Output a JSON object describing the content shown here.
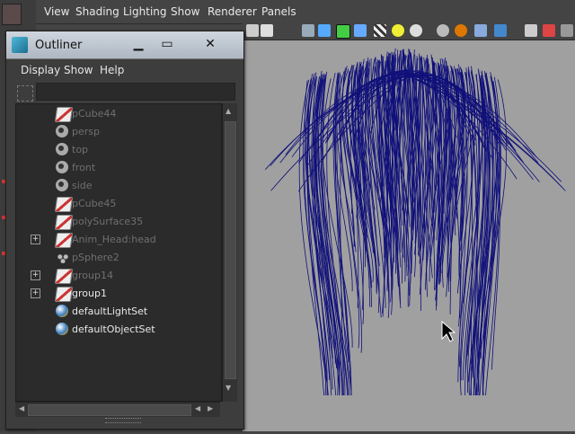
{
  "app_menu": [
    "View",
    "Shading",
    "Lighting",
    "Show",
    "Renderer",
    "Panels"
  ],
  "outliner": {
    "title": "Outliner",
    "menu": [
      "Display",
      "Show",
      "Help"
    ],
    "filter_value": "",
    "items": [
      {
        "label": "pCube44",
        "icon": "mesh-icon",
        "expandable": false,
        "dim": true
      },
      {
        "label": "persp",
        "icon": "camera-icon",
        "expandable": false,
        "dim": true
      },
      {
        "label": "top",
        "icon": "camera-icon",
        "expandable": false,
        "dim": true
      },
      {
        "label": "front",
        "icon": "camera-icon",
        "expandable": false,
        "dim": true
      },
      {
        "label": "side",
        "icon": "camera-icon",
        "expandable": false,
        "dim": true
      },
      {
        "label": "pCube45",
        "icon": "mesh-icon",
        "expandable": false,
        "dim": true
      },
      {
        "label": "polySurface35",
        "icon": "mesh-icon",
        "expandable": false,
        "dim": true
      },
      {
        "label": "Anim_Head:head",
        "icon": "mesh-icon",
        "expandable": true,
        "dim": true
      },
      {
        "label": "pSphere2",
        "icon": "sphere-icon",
        "expandable": false,
        "dim": true
      },
      {
        "label": "group14",
        "icon": "mesh-icon",
        "expandable": true,
        "dim": true
      },
      {
        "label": "group1",
        "icon": "mesh-icon",
        "expandable": true,
        "dim": false
      },
      {
        "label": "defaultLightSet",
        "icon": "set-icon",
        "expandable": false,
        "dim": false
      },
      {
        "label": "defaultObjectSet",
        "icon": "set-icon",
        "expandable": false,
        "dim": false
      }
    ]
  },
  "colors": {
    "hair": "#10107a",
    "viewport_bg": "#a0a0a0",
    "panel_bg": "#3d3d3d"
  }
}
